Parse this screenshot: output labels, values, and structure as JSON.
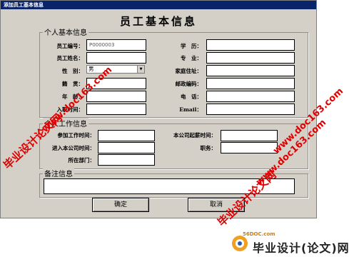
{
  "window": {
    "title": "添加员工基本信息",
    "heading": "员工基本信息"
  },
  "personal": {
    "group_title": "个人基本信息",
    "left_labels": [
      "员工编号：",
      "员工姓名：",
      "性　别：",
      "籍　贯：",
      "年　龄：",
      "入职时间："
    ],
    "right_labels": [
      "学　历：",
      "专　业：",
      "家庭住址：",
      "邮政编码：",
      "电　话：",
      "Email："
    ],
    "employee_id_value": "P0000003",
    "gender_value": "男"
  },
  "work": {
    "group_title": "个人工作信息",
    "join_work_label": "参加工作时间：",
    "join_company_label": "进入本公司时间：",
    "department_label": "所在部门：",
    "salary_start_label": "本公司起薪时间：",
    "position_label": "职务："
  },
  "remarks": {
    "group_title": "备注信息"
  },
  "buttons": {
    "confirm": "确定",
    "cancel": "取消"
  },
  "watermarks": {
    "diag_left": "毕业设计论文网",
    "url_left": "www.doc163.com",
    "diag_mid": "毕业设计论文网",
    "url_mid": "www.doc163.com",
    "url_right": "www.doc163.com",
    "footer_small": "56DOC.com",
    "footer_big": "毕业设计(论文)网"
  }
}
